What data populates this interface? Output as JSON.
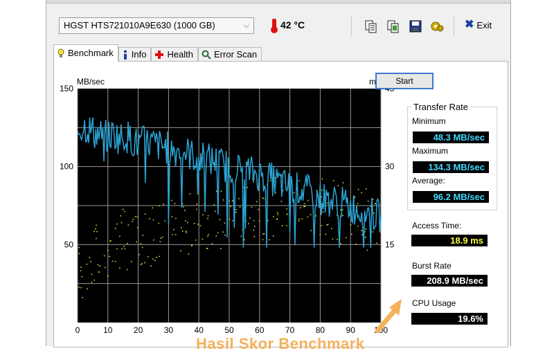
{
  "toolbar": {
    "drive": "HGST   HTS721010A9E630 (1000 GB)",
    "temperature": "42 °C",
    "exit_label": "Exit"
  },
  "tabs": [
    {
      "label": "Benchmark"
    },
    {
      "label": "Info"
    },
    {
      "label": "Health"
    },
    {
      "label": "Error Scan"
    }
  ],
  "benchmark": {
    "start_label": "Start",
    "transfer_rate_title": "Transfer Rate",
    "minimum_label": "Minimum",
    "minimum_value": "48.3 MB/sec",
    "maximum_label": "Maximum",
    "maximum_value": "134.3 MB/sec",
    "average_label": "Average:",
    "average_value": "96.2 MB/sec",
    "access_time_label": "Access Time:",
    "access_time_value": "18.9 ms",
    "burst_rate_label": "Burst Rate",
    "burst_rate_value": "208.9 MB/sec",
    "cpu_usage_label": "CPU Usage",
    "cpu_usage_value": "19.6%"
  },
  "overlay_text": "Hasil Skor Benchmark",
  "colors": {
    "chart_bg": "#000000",
    "transfer_line": "#2aa6d6",
    "access_points": "#d8d83a",
    "grid": "#bbbbbb",
    "accent_border": "#3a78d4",
    "arrow": "#f4b25a"
  },
  "icons": [
    "thermometer-icon",
    "copy-text-icon",
    "copy-screenshot-icon",
    "save-icon",
    "options-icon",
    "exit-icon",
    "benchmark-icon",
    "info-icon",
    "health-icon",
    "error-scan-icon"
  ],
  "chart_data": {
    "type": "line",
    "title": "",
    "ylabel_left": "MB/sec",
    "ylabel_right": "ms",
    "xlim": [
      0,
      100
    ],
    "ylim_left": [
      0,
      150
    ],
    "ylim_right": [
      0,
      45
    ],
    "xticks": [
      0,
      10,
      20,
      30,
      40,
      50,
      60,
      70,
      80,
      90,
      100
    ],
    "yticks_left": [
      50,
      100,
      150
    ],
    "yticks_right": [
      15,
      30,
      45
    ],
    "grid": true,
    "series": [
      {
        "axis": "left",
        "x": [
          0,
          2,
          4,
          6,
          8,
          10,
          12,
          14,
          16,
          18,
          20,
          22,
          24,
          26,
          28,
          30,
          32,
          34,
          36,
          38,
          40,
          42,
          44,
          46,
          48,
          50,
          52,
          54,
          56,
          58,
          60,
          62,
          64,
          66,
          68,
          70,
          72,
          74,
          76,
          78,
          80,
          82,
          84,
          86,
          88,
          90,
          92,
          94,
          96,
          98,
          100
        ],
        "values": [
          123,
          126,
          124,
          121,
          120,
          119,
          121,
          118,
          120,
          117,
          114,
          116,
          115,
          114,
          113,
          112,
          110,
          111,
          109,
          107,
          105,
          106,
          104,
          103,
          101,
          100,
          99,
          98,
          97,
          96,
          95,
          93,
          92,
          90,
          88,
          87,
          86,
          85,
          84,
          82,
          80,
          79,
          78,
          77,
          76,
          74,
          73,
          72,
          70,
          69,
          68
        ]
      },
      {
        "axis": "right",
        "type": "scatter",
        "note_range": "access time samples scattered roughly 5-28 ms, rising left to right",
        "x": [
          1,
          4,
          7,
          10,
          13,
          16,
          19,
          22,
          25,
          28,
          31,
          34,
          37,
          40,
          43,
          46,
          49,
          52,
          55,
          58,
          61,
          64,
          67,
          70,
          73,
          76,
          79,
          82,
          85,
          88,
          91,
          94,
          97
        ],
        "values": [
          10,
          12,
          13,
          14,
          15,
          16,
          16,
          17,
          17,
          18,
          18,
          19,
          19,
          20,
          20,
          20,
          21,
          21,
          21,
          22,
          22,
          22,
          23,
          23,
          23,
          23,
          22,
          22,
          22,
          21,
          21,
          20,
          20
        ]
      }
    ]
  }
}
